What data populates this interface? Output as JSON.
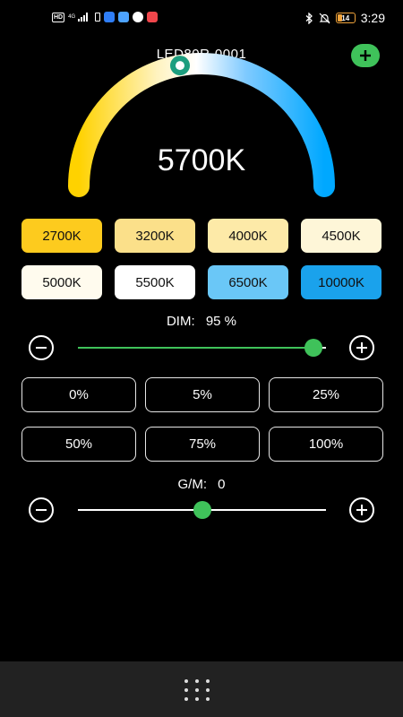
{
  "status_bar": {
    "hd_label": "HD",
    "network_label": "4G",
    "time": "3:29",
    "battery_level": "14",
    "battery_color": "#f1a33a"
  },
  "header": {
    "device_name": "LED80R-0001",
    "add_icon": "plus-icon",
    "accent_color": "#3fc25a"
  },
  "cct": {
    "current_value": "5700K",
    "current_kelvin": 5700,
    "range_kelvin": [
      2700,
      10000
    ],
    "gauge_colors": [
      "#ffd200",
      "#fff3c0",
      "#ffffff",
      "#7fcaff",
      "#00a8ff"
    ]
  },
  "presets": [
    {
      "label": "2700K",
      "color": "#fdcb1e"
    },
    {
      "label": "3200K",
      "color": "#fbe08a"
    },
    {
      "label": "4000K",
      "color": "#fdeaa8"
    },
    {
      "label": "4500K",
      "color": "#fef6d8"
    },
    {
      "label": "5000K",
      "color": "#fffbee"
    },
    {
      "label": "5500K",
      "color": "#ffffff"
    },
    {
      "label": "6500K",
      "color": "#6ac7f7"
    },
    {
      "label": "10000K",
      "color": "#1aa2ec"
    }
  ],
  "dim": {
    "label": "DIM:",
    "value_text": "95 %",
    "value": 95
  },
  "dim_presets": [
    "0%",
    "5%",
    "25%",
    "50%",
    "75%",
    "100%"
  ],
  "gm": {
    "label": "G/M:",
    "value_text": "0",
    "value": 0,
    "range": [
      -50,
      50
    ]
  },
  "bottom_nav": {
    "icon": "app-grid-icon"
  }
}
